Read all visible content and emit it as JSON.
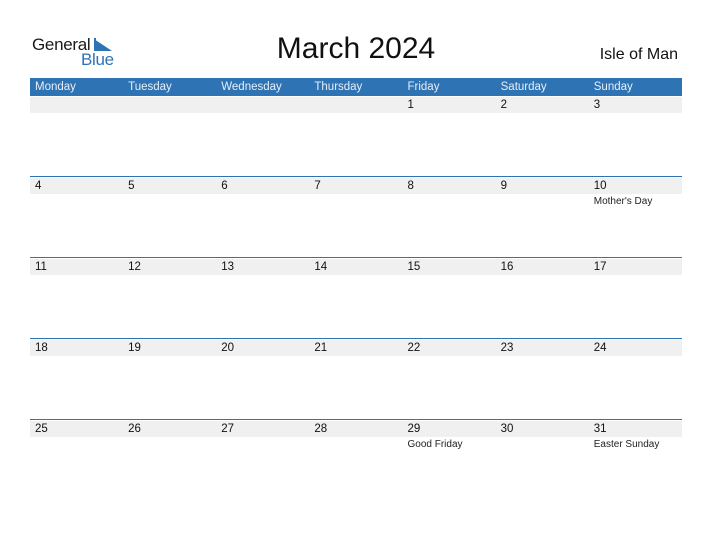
{
  "logo": {
    "line1": "General",
    "line2": "Blue"
  },
  "title": "March 2024",
  "region": "Isle of Man",
  "colors": {
    "accent": "#2E74B5",
    "date_strip": "#F0F0F0"
  },
  "days_of_week": [
    "Monday",
    "Tuesday",
    "Wednesday",
    "Thursday",
    "Friday",
    "Saturday",
    "Sunday"
  ],
  "weeks": [
    [
      {
        "day": ""
      },
      {
        "day": ""
      },
      {
        "day": ""
      },
      {
        "day": ""
      },
      {
        "day": "1"
      },
      {
        "day": "2"
      },
      {
        "day": "3"
      }
    ],
    [
      {
        "day": "4"
      },
      {
        "day": "5"
      },
      {
        "day": "6"
      },
      {
        "day": "7"
      },
      {
        "day": "8"
      },
      {
        "day": "9"
      },
      {
        "day": "10",
        "event": "Mother's Day"
      }
    ],
    [
      {
        "day": "11"
      },
      {
        "day": "12"
      },
      {
        "day": "13"
      },
      {
        "day": "14"
      },
      {
        "day": "15"
      },
      {
        "day": "16"
      },
      {
        "day": "17"
      }
    ],
    [
      {
        "day": "18"
      },
      {
        "day": "19"
      },
      {
        "day": "20"
      },
      {
        "day": "21"
      },
      {
        "day": "22"
      },
      {
        "day": "23"
      },
      {
        "day": "24"
      }
    ],
    [
      {
        "day": "25"
      },
      {
        "day": "26"
      },
      {
        "day": "27"
      },
      {
        "day": "28"
      },
      {
        "day": "29",
        "event": "Good Friday"
      },
      {
        "day": "30"
      },
      {
        "day": "31",
        "event": "Easter Sunday"
      }
    ]
  ]
}
